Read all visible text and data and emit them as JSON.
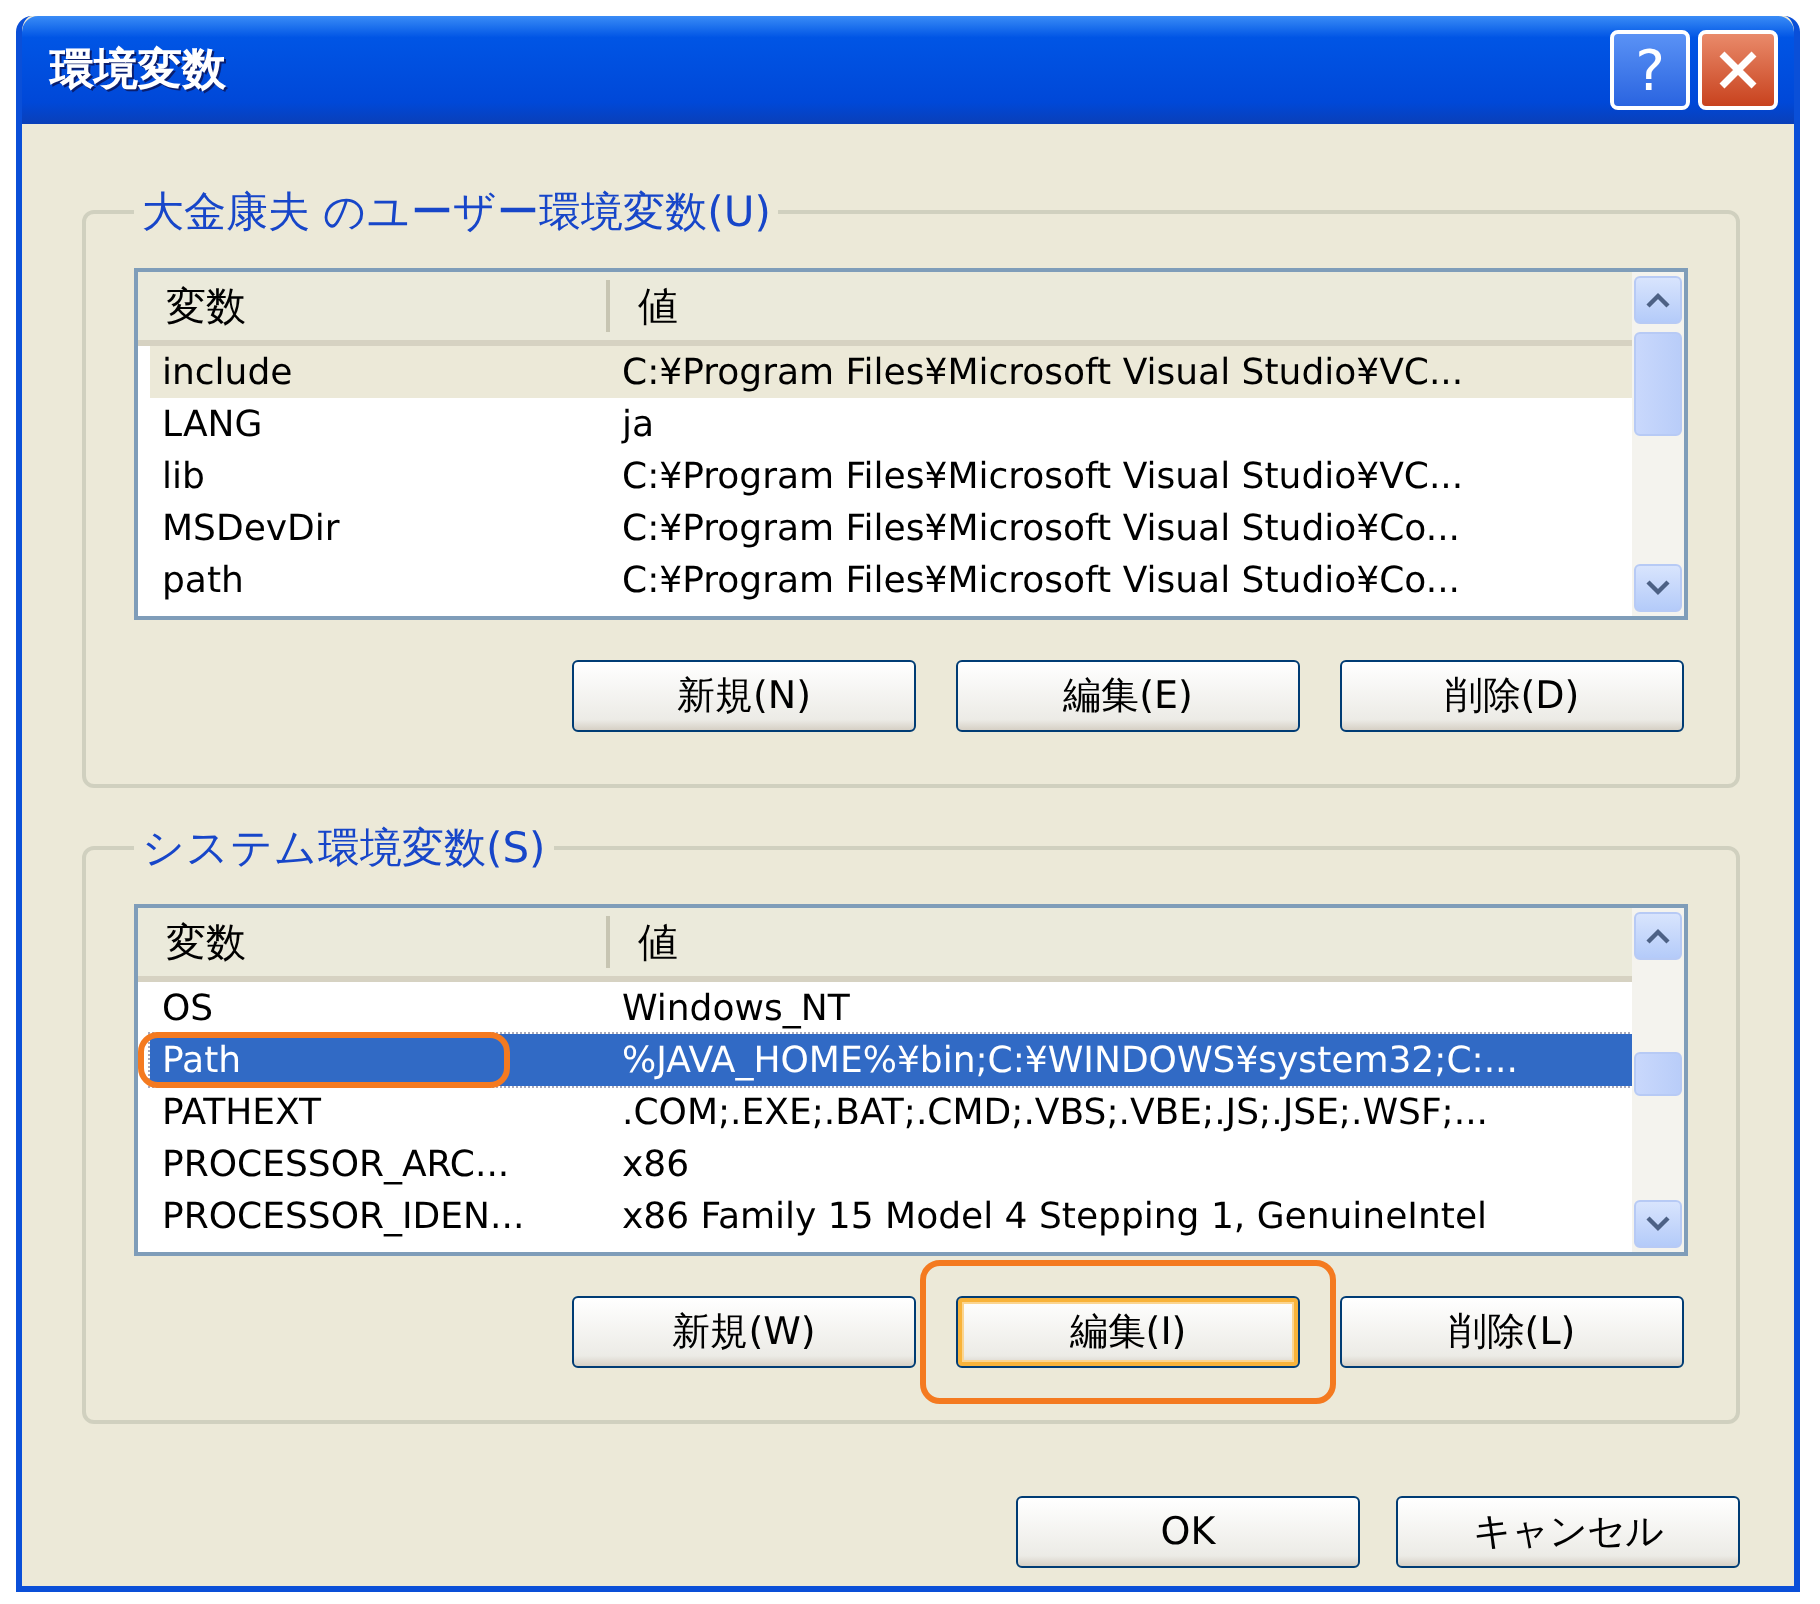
{
  "window": {
    "title": "環境変数",
    "help_button": "?"
  },
  "groups": [
    {
      "title": "大金康夫 のユーザー環境変数(U)",
      "focused": false,
      "columns": [
        "変数",
        "値"
      ],
      "rows": [
        {
          "name": "include",
          "value": "C:¥Program Files¥Microsoft Visual Studio¥VC...",
          "selected": true,
          "highlighted": false
        },
        {
          "name": "LANG",
          "value": "ja",
          "selected": false,
          "highlighted": false
        },
        {
          "name": "lib",
          "value": "C:¥Program Files¥Microsoft Visual Studio¥VC...",
          "selected": false,
          "highlighted": false
        },
        {
          "name": "MSDevDir",
          "value": "C:¥Program Files¥Microsoft Visual Studio¥Co...",
          "selected": false,
          "highlighted": false
        },
        {
          "name": "path",
          "value": "C:¥Program Files¥Microsoft Visual Studio¥Co...",
          "selected": false,
          "highlighted": false
        }
      ],
      "buttons": [
        {
          "label": "新規(N)",
          "focused": false,
          "highlighted": false
        },
        {
          "label": "編集(E)",
          "focused": false,
          "highlighted": false
        },
        {
          "label": "削除(D)",
          "focused": false,
          "highlighted": false
        }
      ]
    },
    {
      "title": "システム環境変数(S)",
      "focused": true,
      "columns": [
        "変数",
        "値"
      ],
      "rows": [
        {
          "name": "OS",
          "value": "Windows_NT",
          "selected": false,
          "highlighted": false
        },
        {
          "name": "Path",
          "value": "%JAVA_HOME%¥bin;C:¥WINDOWS¥system32;C:...",
          "selected": true,
          "highlighted": true
        },
        {
          "name": "PATHEXT",
          "value": ".COM;.EXE;.BAT;.CMD;.VBS;.VBE;.JS;.JSE;.WSF;...",
          "selected": false,
          "highlighted": false
        },
        {
          "name": "PROCESSOR_ARC...",
          "value": "x86",
          "selected": false,
          "highlighted": false
        },
        {
          "name": "PROCESSOR_IDEN...",
          "value": "x86 Family 15 Model 4 Stepping 1, GenuineIntel",
          "selected": false,
          "highlighted": false
        }
      ],
      "buttons": [
        {
          "label": "新規(W)",
          "focused": false,
          "highlighted": false
        },
        {
          "label": "編集(I)",
          "focused": true,
          "highlighted": true
        },
        {
          "label": "削除(L)",
          "focused": false,
          "highlighted": false
        }
      ]
    }
  ],
  "dialog_buttons": [
    "OK",
    "キャンセル"
  ]
}
